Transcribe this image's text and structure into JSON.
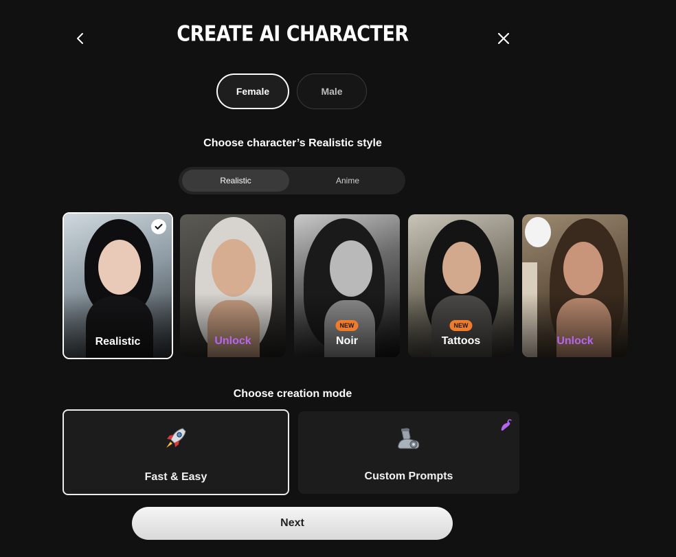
{
  "header": {
    "title": "CREATE AI CHARACTER"
  },
  "gender": {
    "options": [
      {
        "label": "Female",
        "selected": true
      },
      {
        "label": "Male",
        "selected": false
      }
    ]
  },
  "style_section": {
    "heading": "Choose character’s Realistic style",
    "switch": [
      {
        "label": "Realistic",
        "selected": true
      },
      {
        "label": "Anime",
        "selected": false
      }
    ],
    "cards": [
      {
        "label": "Realistic",
        "selected": true,
        "locked": false,
        "badge": ""
      },
      {
        "label": "Unlock",
        "selected": false,
        "locked": true,
        "badge": ""
      },
      {
        "label": "Noir",
        "selected": false,
        "locked": false,
        "badge": "NEW"
      },
      {
        "label": "Tattoos",
        "selected": false,
        "locked": false,
        "badge": "NEW"
      },
      {
        "label": "Unlock",
        "selected": false,
        "locked": true,
        "badge": ""
      }
    ]
  },
  "mode_section": {
    "heading": "Choose creation mode",
    "modes": [
      {
        "label": "Fast & Easy",
        "icon": "rocket-icon",
        "selected": true
      },
      {
        "label": "Custom Prompts",
        "icon": "mechanical-arm-icon",
        "selected": false
      }
    ]
  },
  "next_button": {
    "label": "Next"
  },
  "colors": {
    "background": "#111111",
    "locked_label": "#b565f0",
    "new_badge": "#f07b2a",
    "card_surface": "#1c1c1c"
  }
}
